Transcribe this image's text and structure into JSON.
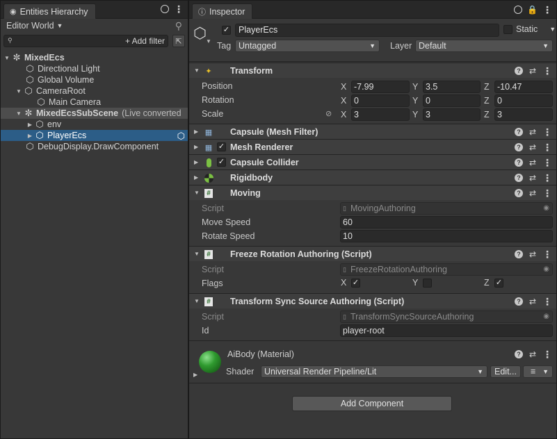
{
  "hierarchy": {
    "tab_title": "Entities Hierarchy",
    "world_selector": "Editor World",
    "add_filter_label": "+ Add filter",
    "nodes": [
      {
        "label": "MixedEcs"
      },
      {
        "label": "Directional Light"
      },
      {
        "label": "Global Volume"
      },
      {
        "label": "CameraRoot"
      },
      {
        "label": "Main Camera"
      },
      {
        "label": "MixedEcsSubScene",
        "suffix": "(Live converted"
      },
      {
        "label": "env"
      },
      {
        "label": "PlayerEcs"
      },
      {
        "label": "DebugDisplay.DrawComponent"
      }
    ]
  },
  "inspector": {
    "tab_title": "Inspector",
    "object_name": "PlayerEcs",
    "static_label": "Static",
    "tag_label": "Tag",
    "tag_value": "Untagged",
    "layer_label": "Layer",
    "layer_value": "Default",
    "transform": {
      "title": "Transform",
      "position_label": "Position",
      "rotation_label": "Rotation",
      "scale_label": "Scale",
      "x_label": "X",
      "y_label": "Y",
      "z_label": "Z",
      "position": {
        "x": "-7.99",
        "y": "3.5",
        "z": "-10.47"
      },
      "rotation": {
        "x": "0",
        "y": "0",
        "z": "0"
      },
      "scale": {
        "x": "3",
        "y": "3",
        "z": "3"
      }
    },
    "components": {
      "mesh_filter": "Capsule (Mesh Filter)",
      "mesh_renderer": "Mesh Renderer",
      "capsule_collider": "Capsule Collider",
      "rigidbody": "Rigidbody"
    },
    "moving": {
      "title": "Moving",
      "script_label": "Script",
      "script_value": "MovingAuthoring",
      "move_speed_label": "Move Speed",
      "move_speed_value": "60",
      "rotate_speed_label": "Rotate Speed",
      "rotate_speed_value": "10"
    },
    "freeze": {
      "title": "Freeze Rotation Authoring (Script)",
      "script_label": "Script",
      "script_value": "FreezeRotationAuthoring",
      "flags_label": "Flags",
      "x_label": "X",
      "y_label": "Y",
      "z_label": "Z"
    },
    "sync": {
      "title": "Transform Sync Source Authoring (Script)",
      "script_label": "Script",
      "script_value": "TransformSyncSourceAuthoring",
      "id_label": "Id",
      "id_value": "player-root"
    },
    "material": {
      "name": "AiBody (Material)",
      "shader_label": "Shader",
      "shader_value": "Universal Render Pipeline/Lit",
      "edit_label": "Edit..."
    },
    "add_component_label": "Add Component"
  },
  "colors": {
    "selection": "#2c5d87",
    "panel": "#383838",
    "header": "#3e3e3e"
  }
}
